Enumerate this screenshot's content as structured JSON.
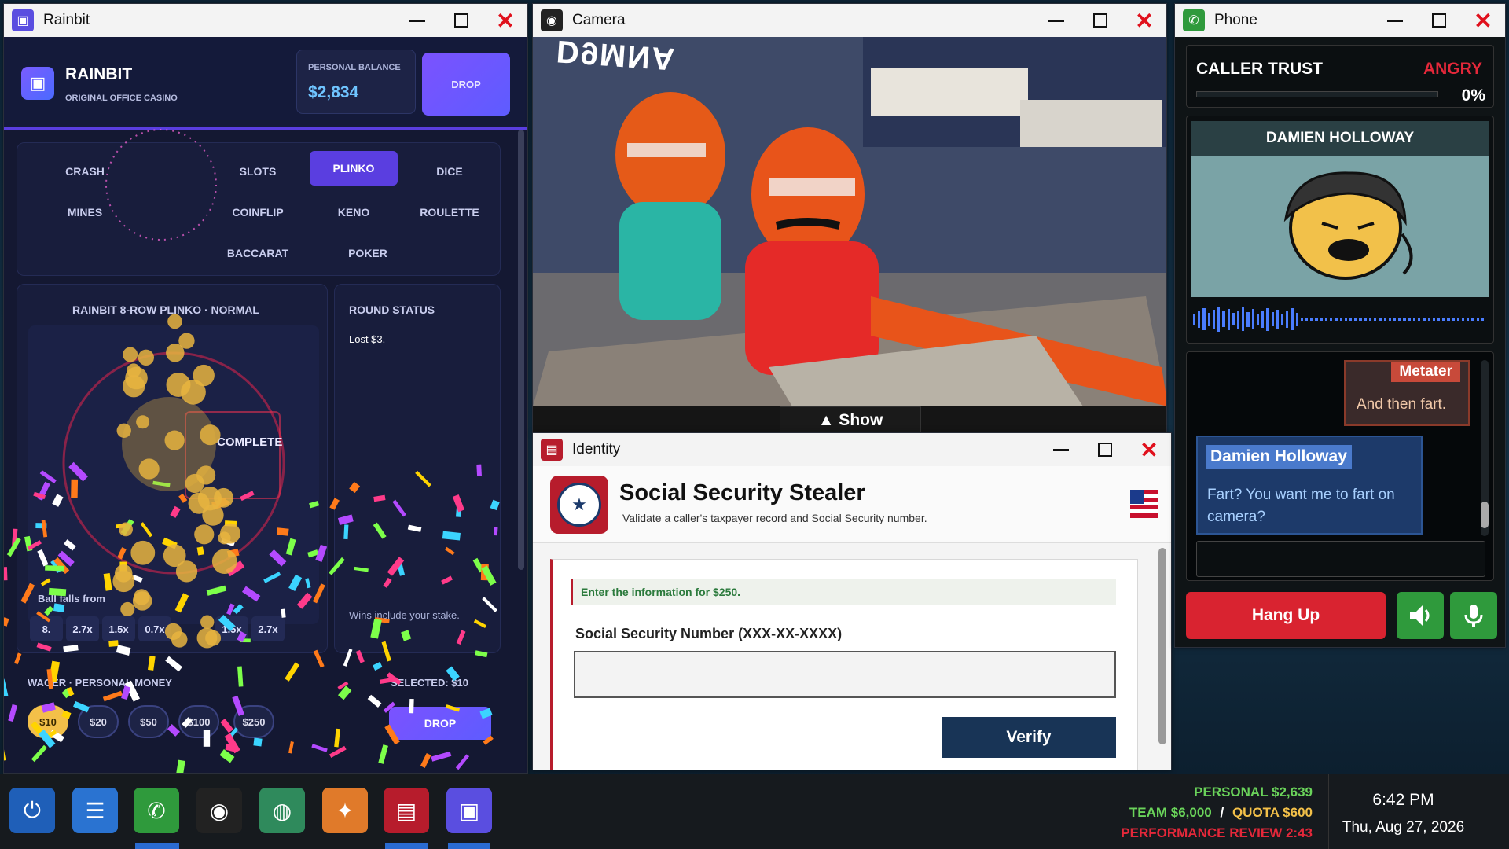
{
  "rainbit": {
    "window_title": "Rainbit",
    "brand": "RAINBIT",
    "tagline": "ORIGINAL OFFICE CASINO",
    "balance_label": "PERSONAL BALANCE",
    "balance_value": "$2,834",
    "drop_label": "DROP",
    "games": [
      "CRASH",
      "SLOTS",
      "PLINKO",
      "DICE",
      "MINES",
      "COINFLIP",
      "KENO",
      "ROULETTE",
      "BACCARAT",
      "POKER"
    ],
    "active_game": "PLINKO",
    "board_title": "RAINBIT 8-ROW PLINKO · NORMAL",
    "board_status": "COMPLETE",
    "board_note": "Ball falls from",
    "multipliers": [
      "8.",
      "2.7x",
      "1.5x",
      "0.7x",
      "1.5x",
      "2.7x"
    ],
    "round_status_title": "ROUND STATUS",
    "round_status_text": "Lost $3.",
    "round_note": "Wins include your stake.",
    "wager_label": "WAGER · PERSONAL MONEY",
    "selected_label": "SELECTED: $10",
    "chips": [
      "$10",
      "$20",
      "$50",
      "$100",
      "$250"
    ],
    "drop_button": "DROP",
    "accent": "#5a3ee0"
  },
  "camera": {
    "window_title": "Camera",
    "show_label": "▲ Show",
    "sign_text": "D9MNA"
  },
  "identity": {
    "window_title": "Identity",
    "title": "Social Security Stealer",
    "subtitle": "Validate a caller's taxpayer record and Social Security number.",
    "note": "Enter the information for $250.",
    "field_label": "Social Security Number (XXX-XX-XXXX)",
    "field_value": "",
    "verify_label": "Verify"
  },
  "phone": {
    "window_title": "Phone",
    "trust_label": "CALLER TRUST",
    "trust_mood": "ANGRY",
    "trust_percent": "0%",
    "trust_fraction": 0,
    "caller_name": "DAMIEN HOLLOWAY",
    "messages": [
      {
        "sender": "Metater",
        "text": "And then fart."
      },
      {
        "sender": "Damien Holloway",
        "text": "Fart? You want me to fart on camera?"
      }
    ],
    "hangup_label": "Hang Up"
  },
  "taskbar": {
    "personal": "PERSONAL $2,639",
    "team": "TEAM $6,000",
    "separator": "/",
    "quota": "QUOTA $600",
    "review": "PERFORMANCE REVIEW 2:43",
    "time": "6:42 PM",
    "date": "Thu, Aug 27, 2026",
    "icons": [
      "power-icon",
      "document-icon",
      "phone-icon",
      "camera-icon",
      "globe-icon",
      "muni-icon",
      "identity-icon",
      "rainbit-icon"
    ]
  }
}
